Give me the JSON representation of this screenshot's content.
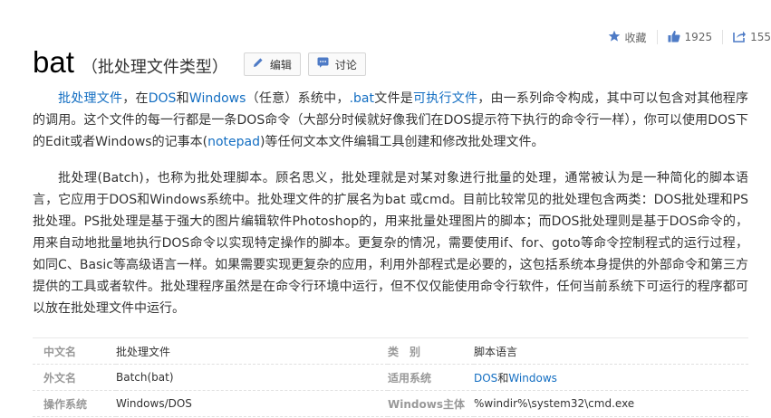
{
  "topbar": {
    "collect_label": "收藏",
    "like_count": "1925",
    "share_count": "155"
  },
  "header": {
    "title": "bat",
    "subtitle": "（批处理文件类型）",
    "edit_label": "编辑",
    "discuss_label": "讨论"
  },
  "paragraph1": {
    "l_batch_file": "批处理文件",
    "t1": "，在",
    "l_dos": "DOS",
    "t2": "和",
    "l_windows": "Windows",
    "t3": "（任意）系统中，",
    "l_bat": ".bat",
    "t4": "文件是",
    "l_exec": "可执行文件",
    "t5": "，由一系列命令构成，其中可以包含对其他程序的调用。这个文件的每一行都是一条DOS命令（大部分时候就好像我们在DOS提示符下执行的命令行一样），你可以使用DOS下的Edit或者Windows的记事本(",
    "l_notepad": "notepad",
    "t6": ")等任何文本文件编辑工具创建和修改批处理文件。"
  },
  "paragraph2": {
    "text": "批处理(Batch)，也称为批处理脚本。顾名思义，批处理就是对某对象进行批量的处理，通常被认为是一种简化的脚本语言，它应用于DOS和Windows系统中。批处理文件的扩展名为bat 或cmd。目前比较常见的批处理包含两类：DOS批处理和PS批处理。PS批处理是基于强大的图片编辑软件Photoshop的，用来批量处理图片的脚本；而DOS批处理则是基于DOS命令的，用来自动地批量地执行DOS命令以实现特定操作的脚本。更复杂的情况，需要使用if、for、goto等命令控制程式的运行过程，如同C、Basic等高级语言一样。如果需要实现更复杂的应用，利用外部程式是必要的，这包括系统本身提供的外部命令和第三方提供的工具或者软件。批处理程序虽然是在命令行环境中运行，但不仅仅能使用命令行软件，任何当前系统下可运行的程序都可以放在批处理文件中运行。"
  },
  "basic_info": {
    "r1": {
      "k1": "中文名",
      "v1": "批处理文件",
      "k2": "类　别",
      "v2": "脚本语言"
    },
    "r2": {
      "k1": "外文名",
      "v1": "Batch(bat)",
      "k2": "适用系统",
      "v2a": "DOS",
      "v2b": "和",
      "v2c": "Windows"
    },
    "r3": {
      "k1": "操作系统",
      "v1": "Windows/DOS",
      "k2": "Windows主体",
      "v2": "%windir%\\system32\\cmd.exe"
    }
  },
  "colors": {
    "link": "#136ec2",
    "icon": "#4e7bc6",
    "label": "#999999"
  },
  "icons": [
    "star-icon",
    "thumb-up-icon",
    "share-icon",
    "pencil-icon",
    "chat-icon"
  ]
}
